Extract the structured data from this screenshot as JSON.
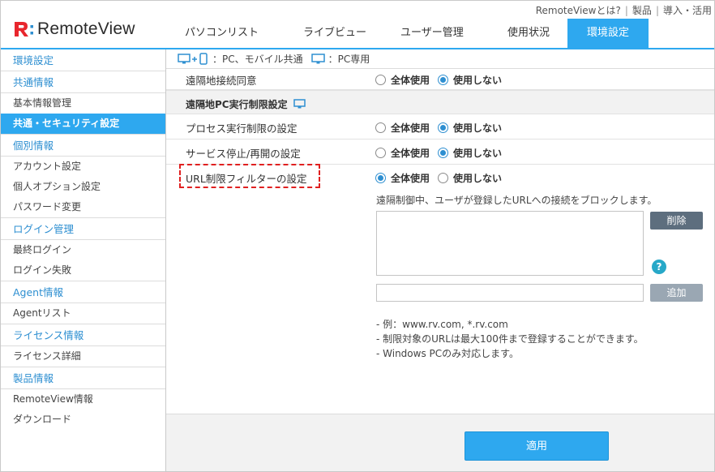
{
  "header": {
    "top_links": [
      "RemoteViewとは?",
      "製品",
      "導入・活用"
    ],
    "logo_text": "RemoteView",
    "nav_tabs": [
      {
        "label": "パソコンリスト",
        "active": false
      },
      {
        "label": "ライブビュー",
        "active": false
      },
      {
        "label": "ユーザー管理",
        "active": false
      },
      {
        "label": "使用状況",
        "active": false
      },
      {
        "label": "環境設定",
        "active": true
      }
    ]
  },
  "sidebar": {
    "groups": [
      {
        "title": "環境設定",
        "items": []
      },
      {
        "title": "共通情報",
        "items": [
          "基本情報管理",
          "共通・セキュリティ設定"
        ]
      },
      {
        "title": "個別情報",
        "items": [
          "アカウント設定",
          "個人オプション設定",
          "パスワード変更"
        ]
      },
      {
        "title": "ログイン管理",
        "items": [
          "最終ログイン",
          "ログイン失敗"
        ]
      },
      {
        "title": "Agent情報",
        "items": [
          "Agentリスト"
        ]
      },
      {
        "title": "ライセンス情報",
        "items": [
          "ライセンス詳細"
        ]
      },
      {
        "title": "製品情報",
        "items": [
          "RemoteView情報",
          "ダウンロード"
        ]
      }
    ],
    "active_item": "共通・セキュリティ設定"
  },
  "main": {
    "legend": {
      "pc_mobile": "：PC、モバイル共通",
      "pc_only": "：PC専用"
    },
    "rows": {
      "remote_consent": {
        "label": "遠隔地接続同意",
        "option_all": "全体使用",
        "option_none": "使用しない",
        "selected": "none"
      },
      "section_title": "遠隔地PC実行制限設定",
      "process_limit": {
        "label": "プロセス実行制限の設定",
        "option_all": "全体使用",
        "option_none": "使用しない",
        "selected": "none"
      },
      "service_stop": {
        "label": "サービス停止/再開の設定",
        "option_all": "全体使用",
        "option_none": "使用しない",
        "selected": "none"
      },
      "url_filter": {
        "label": "URL制限フィルターの設定",
        "option_all": "全体使用",
        "option_none": "使用しない",
        "selected": "all"
      }
    },
    "url_filter_panel": {
      "description": "遠隔制御中、ユーザが登録したURLへの接続をブロックします。",
      "delete_label": "削除",
      "add_label": "追加",
      "help_label": "?",
      "url_input_value": "",
      "notes": [
        "- 例：www.rv.com, *.rv.com",
        "- 制限対象のURLは最大100件まで登録することができます。",
        "- Windows PCのみ対応します。"
      ]
    },
    "apply_label": "適用"
  },
  "colors": {
    "accent": "#2ea8ef",
    "link": "#2e8fd1",
    "logo_red": "#e8262d",
    "highlight_dashed": "#e02020"
  }
}
